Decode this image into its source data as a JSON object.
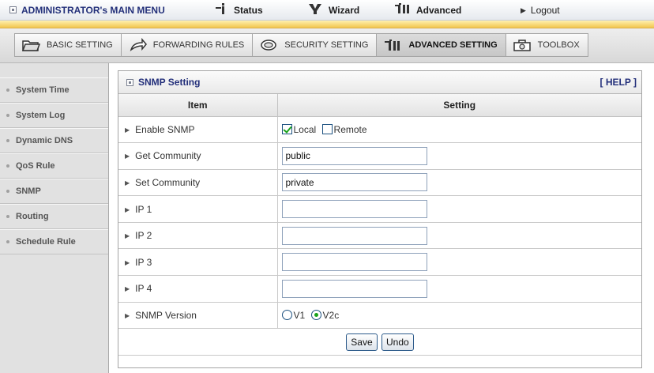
{
  "topbar": {
    "title": "ADMINISTRATOR's MAIN MENU",
    "items": [
      {
        "label": "Status",
        "icon": "status-icon"
      },
      {
        "label": "Wizard",
        "icon": "wizard-icon"
      },
      {
        "label": "Advanced",
        "icon": "advanced-icon"
      },
      {
        "label": "Logout",
        "icon": "arrow-right-icon"
      }
    ]
  },
  "tabs": [
    {
      "label": "BASIC SETTING",
      "icon": "folder-icon"
    },
    {
      "label": "FORWARDING RULES",
      "icon": "forward-icon"
    },
    {
      "label": "SECURITY SETTING",
      "icon": "lock-icon"
    },
    {
      "label": "ADVANCED SETTING",
      "icon": "advanced-icon",
      "active": true
    },
    {
      "label": "TOOLBOX",
      "icon": "toolbox-icon"
    }
  ],
  "sidebar": {
    "items": [
      {
        "label": "System Time"
      },
      {
        "label": "System Log"
      },
      {
        "label": "Dynamic DNS"
      },
      {
        "label": "QoS Rule"
      },
      {
        "label": "SNMP"
      },
      {
        "label": "Routing"
      },
      {
        "label": "Schedule Rule"
      }
    ]
  },
  "panel": {
    "title": "SNMP Setting",
    "help": "[ HELP ]",
    "col_item": "Item",
    "col_setting": "Setting",
    "rows": {
      "enable_snmp": {
        "label": "Enable SNMP",
        "local": "Local",
        "remote": "Remote",
        "local_checked": true,
        "remote_checked": false
      },
      "get_community": {
        "label": "Get Community",
        "value": "public"
      },
      "set_community": {
        "label": "Set Community",
        "value": "private"
      },
      "ip1": {
        "label": "IP 1",
        "value": ""
      },
      "ip2": {
        "label": "IP 2",
        "value": ""
      },
      "ip3": {
        "label": "IP 3",
        "value": ""
      },
      "ip4": {
        "label": "IP 4",
        "value": ""
      },
      "snmp_version": {
        "label": "SNMP Version",
        "v1": "V1",
        "v2c": "V2c",
        "selected": "V2c"
      }
    },
    "save_label": "Save",
    "undo_label": "Undo"
  },
  "colors": {
    "title_blue": "#24317a",
    "band_yellow": "#f2c64e",
    "check_green": "#19a319"
  }
}
